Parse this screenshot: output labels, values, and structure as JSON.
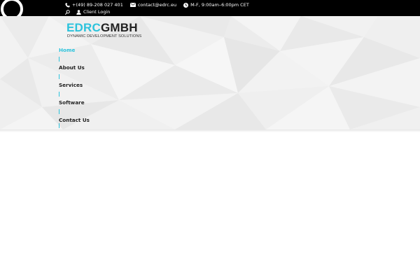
{
  "topbar": {
    "phone": "+(49) 89-208 027 401",
    "email": "contact@edrc.eu",
    "hours": "M-F, 9:00am–6:00pm CET",
    "login_label": "Client Login"
  },
  "logo": {
    "part1": "EDRC",
    "part2": "GMBH",
    "tagline": "DYNAMIC DEVELOPMENT SOLUTIONS"
  },
  "nav": {
    "items": [
      {
        "label": "Home"
      },
      {
        "label": "About Us"
      },
      {
        "label": "Services"
      },
      {
        "label": "Software"
      },
      {
        "label": "Contact Us"
      }
    ]
  },
  "icons": {
    "phone": "phone-icon",
    "email": "envelope-icon",
    "hours": "clock-icon",
    "search": "search-icon",
    "login": "user-icon",
    "loader": "loading-spinner-icon"
  },
  "colors": {
    "accent": "#2cc3dc",
    "topbar_bg": "#000000",
    "header_bg": "#efefef",
    "text_dark": "#222222"
  }
}
